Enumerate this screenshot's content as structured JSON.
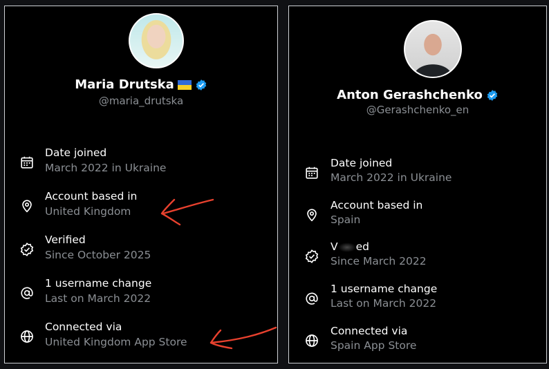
{
  "profiles": [
    {
      "name": "Maria Drutska",
      "handle": "@maria_drutska",
      "has_flag": true,
      "verified_badge": true,
      "rows": [
        {
          "icon": "calendar-icon",
          "title": "Date joined",
          "sub": "March 2022 in Ukraine"
        },
        {
          "icon": "location-pin-icon",
          "title": "Account based in",
          "sub": "United Kingdom"
        },
        {
          "icon": "verified-check-icon",
          "title": "Verified",
          "sub": "Since October 2025"
        },
        {
          "icon": "at-sign-icon",
          "title": "1 username change",
          "sub": "Last on March 2022"
        },
        {
          "icon": "globe-icon",
          "title": "Connected via",
          "sub": "United Kingdom App Store"
        }
      ]
    },
    {
      "name": "Anton Gerashchenko",
      "handle": "@Gerashchenko_en",
      "has_flag": false,
      "verified_badge": true,
      "rows": [
        {
          "icon": "calendar-icon",
          "title": "Date joined",
          "sub": "March 2022 in Ukraine"
        },
        {
          "icon": "location-pin-icon",
          "title": "Account based in",
          "sub": "Spain"
        },
        {
          "icon": "verified-check-icon",
          "title_prefix": "V",
          "title_suffix": "ed",
          "sub": "Since March 2022"
        },
        {
          "icon": "at-sign-icon",
          "title": "1 username change",
          "sub": "Last on March 2022"
        },
        {
          "icon": "globe-icon",
          "title": "Connected via",
          "sub": "Spain App Store"
        }
      ]
    }
  ],
  "colors": {
    "background": "#000000",
    "primary_text": "#ffffff",
    "secondary_text": "#8b8f94",
    "verified_blue": "#1d9bf0",
    "annotation_arrow": "#e8412e"
  }
}
